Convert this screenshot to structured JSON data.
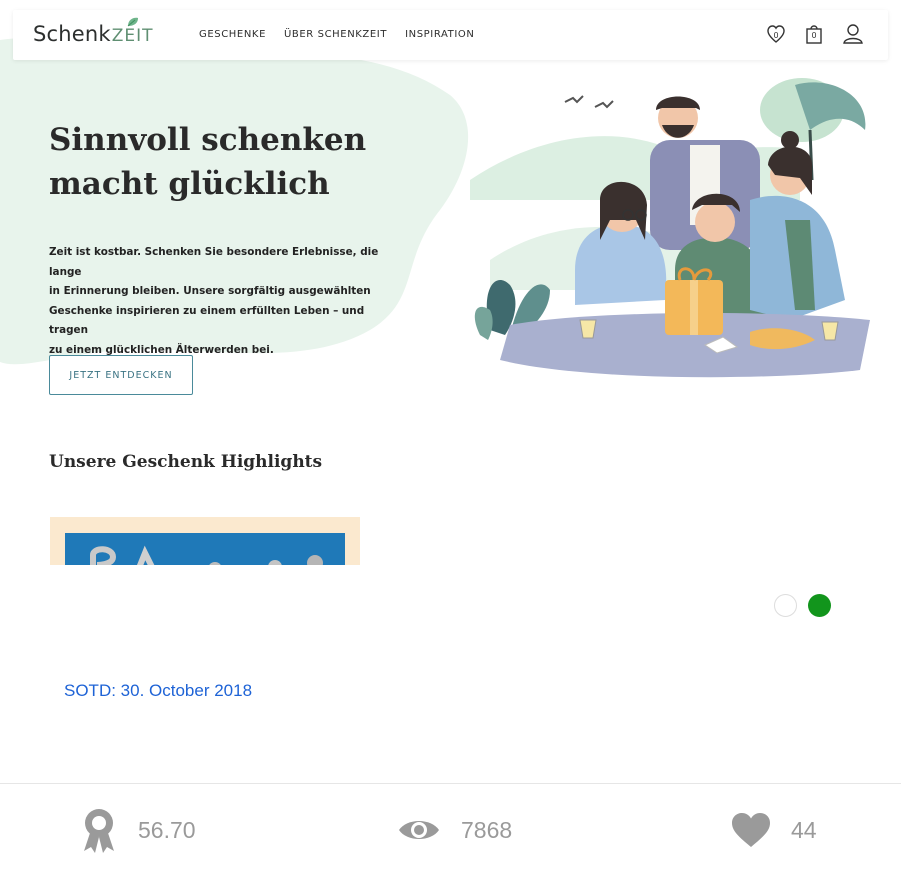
{
  "navbar": {
    "logo": {
      "schenk": "Schenk",
      "zeit": "ZEIT"
    },
    "links": [
      "GESCHENKE",
      "ÜBER SCHENKZEIT",
      "INSPIRATION"
    ],
    "icons": [
      {
        "name": "wishlist-heart-icon",
        "count": "0"
      },
      {
        "name": "gift-bag-icon",
        "count": "0"
      },
      {
        "name": "user-icon",
        "count": ""
      }
    ]
  },
  "hero": {
    "title_line1": "Sinnvoll schenken",
    "title_line2": "macht glücklich",
    "text_line1": "Zeit ist kostbar. Schenken Sie besondere Erlebnisse, die lange",
    "text_line2": "in Erinnerung bleiben. Unsere sorgfältig ausgewählten",
    "text_line3": "Geschenke inspirieren zu einem erfüllten Leben – und tragen",
    "text_line4": "zu einem glücklichen Älterwerden bei.",
    "cta": "JETZT ENTDECKEN"
  },
  "highlights": {
    "title": "Unsere Geschenk Highlights"
  },
  "slider": {
    "active_index": 1,
    "count": 2
  },
  "sotd": "SOTD: 30. October 2018",
  "stats": {
    "score": "56.70",
    "views": "7868",
    "likes": "44"
  },
  "colors": {
    "accent_green": "#12951c",
    "link_blue": "#1e63d6",
    "cta_teal": "#3a7383",
    "blob_mint": "#e6f3ea",
    "stat_gray": "#9a9a9a"
  }
}
